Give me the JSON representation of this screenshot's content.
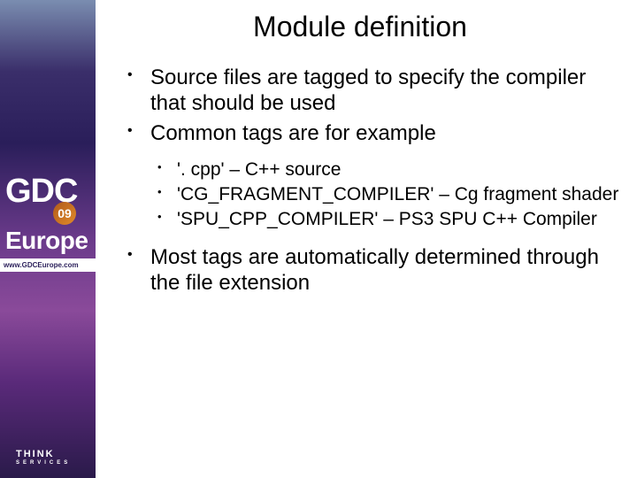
{
  "sidebar": {
    "logo_line1": "GDC",
    "badge": "09",
    "logo_line2": "Europe",
    "url": "www.GDCEurope.com",
    "footer_brand": "THINK",
    "footer_sub": "SERVICES"
  },
  "slide": {
    "title": "Module definition",
    "bullets": [
      {
        "text": "Source files are tagged to specify the compiler that should be used"
      },
      {
        "text": "Common tags are for example",
        "children": [
          {
            "text": "'. cpp' – C++ source"
          },
          {
            "text": "'CG_FRAGMENT_COMPILER' – Cg fragment shader"
          },
          {
            "text": "'SPU_CPP_COMPILER' – PS3 SPU C++ Compiler"
          }
        ]
      },
      {
        "text": "Most tags are automatically determined through the file extension"
      }
    ]
  }
}
